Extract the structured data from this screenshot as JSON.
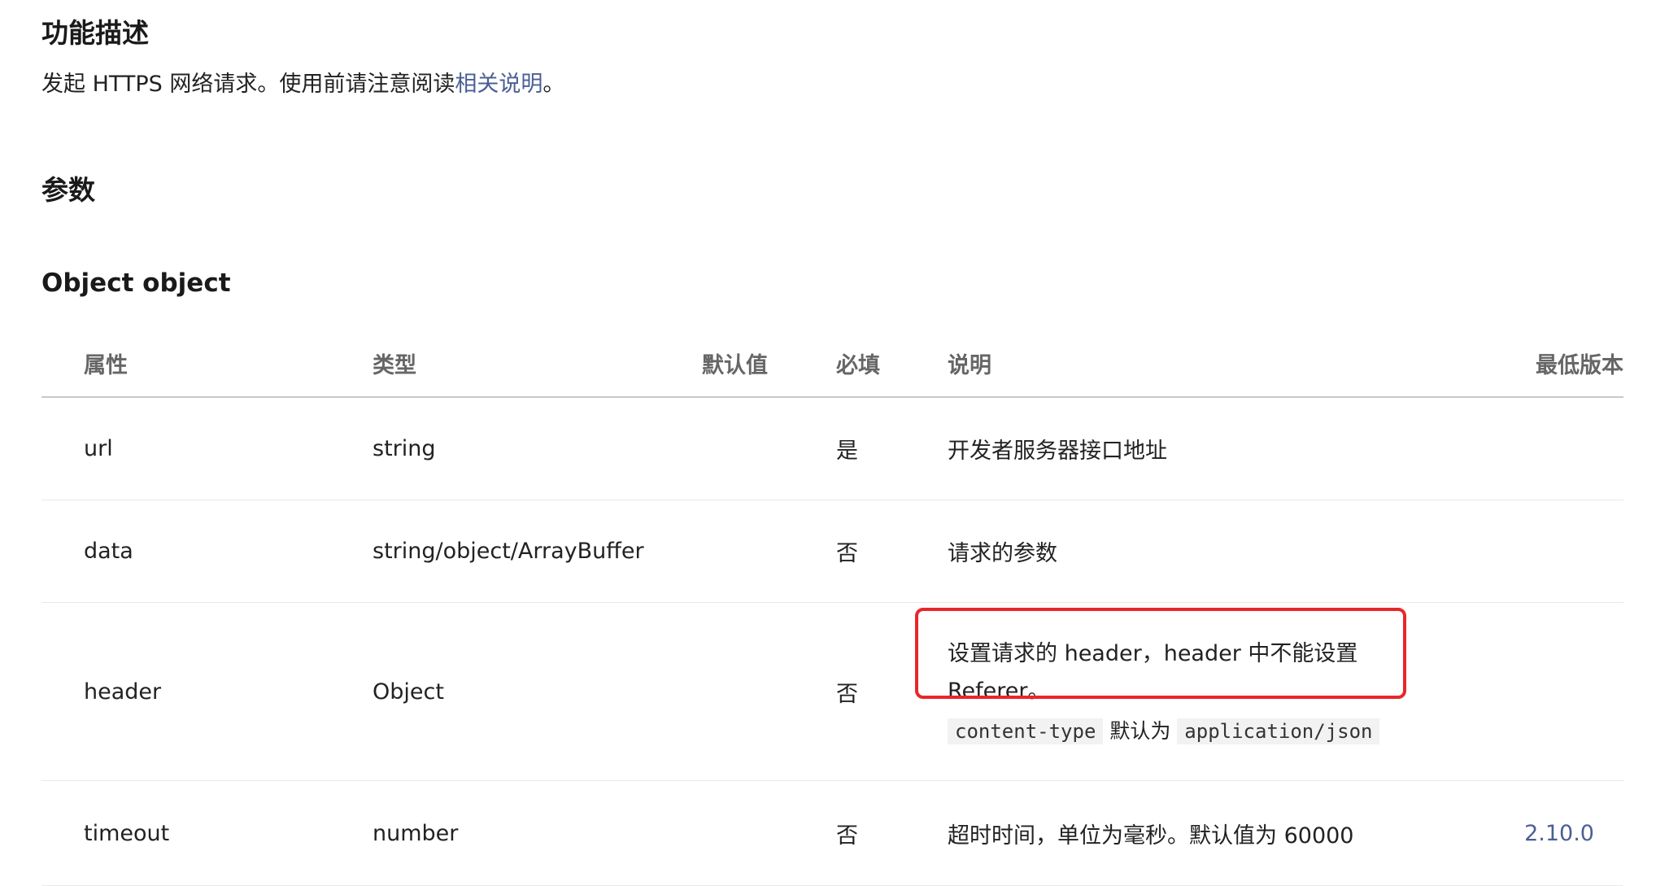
{
  "headings": {
    "function": "功能描述",
    "params": "参数"
  },
  "intro": {
    "text_before": "发起 HTTPS 网络请求。使用前请注意阅读",
    "link_text": "相关说明",
    "text_after": "。"
  },
  "object_title": "Object object",
  "table": {
    "headers": {
      "name": "属性",
      "type": "类型",
      "default": "默认值",
      "required": "必填",
      "description": "说明",
      "version": "最低版本"
    },
    "rows": [
      {
        "name": "url",
        "type": "string",
        "default": "",
        "required": "是",
        "description": "开发者服务器接口地址",
        "version": ""
      },
      {
        "name": "data",
        "type": "string/object/ArrayBuffer",
        "default": "",
        "required": "否",
        "description": "请求的参数",
        "version": ""
      },
      {
        "name": "header",
        "type": "Object",
        "default": "",
        "required": "否",
        "description": "设置请求的 header，header 中不能设置 Referer。",
        "code1": "content-type",
        "code_mid": " 默认为 ",
        "code2": "application/json",
        "version": ""
      },
      {
        "name": "timeout",
        "type": "number",
        "default": "",
        "required": "否",
        "description": "超时时间，单位为毫秒。默认值为 60000",
        "version": "2.10.0"
      }
    ]
  },
  "colors": {
    "link": "#4a5f95",
    "highlight": "#e8272b"
  }
}
